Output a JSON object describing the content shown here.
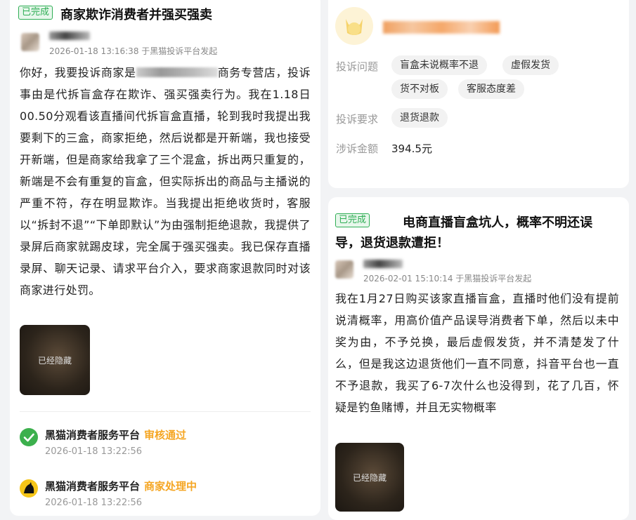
{
  "left": {
    "badge": "已完成",
    "title": "商家欺诈消费者并强买强卖",
    "meta": "2026-01-18 13:16:38 于黑猫投诉平台发起",
    "body_pre": "你好，我要投诉商家是",
    "body_post": "商务专营店，投诉事由是代拆盲盒存在欺诈、强买强卖行为。我在1.18日00.50分观看该直播间代拆盲盒直播，轮到我时我提出我要剩下的三盒，商家拒绝，然后说都是开新端，我也接受开新端，但是商家给我拿了三个混盒，拆出两只重复的，新端是不会有重复的盲盒，但实际拆出的商品与主播说的严重不符，存在明显欺诈。当我提出拒绝收货时，客服以“拆封不退”“下单即默认”为由强制拒绝退款，我提供了录屏后商家就踢皮球，完全属于强买强卖。我已保存直播录屏、聊天记录、请求平台介入，要求商家退款同时对该商家进行处罚。",
    "hidden_image_label": "已经隐藏",
    "timeline": [
      {
        "org": "黑猫消费者服务平台",
        "status": "审核通过",
        "time": "2026-01-18 13:22:56"
      },
      {
        "org": "黑猫消费者服务平台",
        "status": "商家处理中",
        "time": "2026-01-18 13:22:56"
      }
    ]
  },
  "right_top": {
    "labels": {
      "issue": "投诉问题",
      "request": "投诉要求",
      "amount": "涉诉金额"
    },
    "issues": [
      "盲盒未说概率不退",
      "虚假发货",
      "货不对板",
      "客服态度差"
    ],
    "requests": [
      "退货退款"
    ],
    "amount": "394.5元"
  },
  "right_bottom": {
    "badge": "已完成",
    "title": "电商直播盲盒坑人，概率不明还误导，退货退款遭拒！",
    "meta": "2026-02-01 15:10:14 于黑猫投诉平台发起",
    "body": "我在1月27日购买该家直播盲盒，直播时他们没有提前说清概率，用高价值产品误导消费者下单，然后以未中奖为由，不予兑换，最后虚假发货，并不清楚发了什么，但是我这边退货他们一直不同意，抖音平台也一直不予退款，我买了6-7次什么也没得到，花了几百，怀疑是钓鱼赌博，并且无实物概率",
    "hidden_image_label": "已经隐藏"
  }
}
